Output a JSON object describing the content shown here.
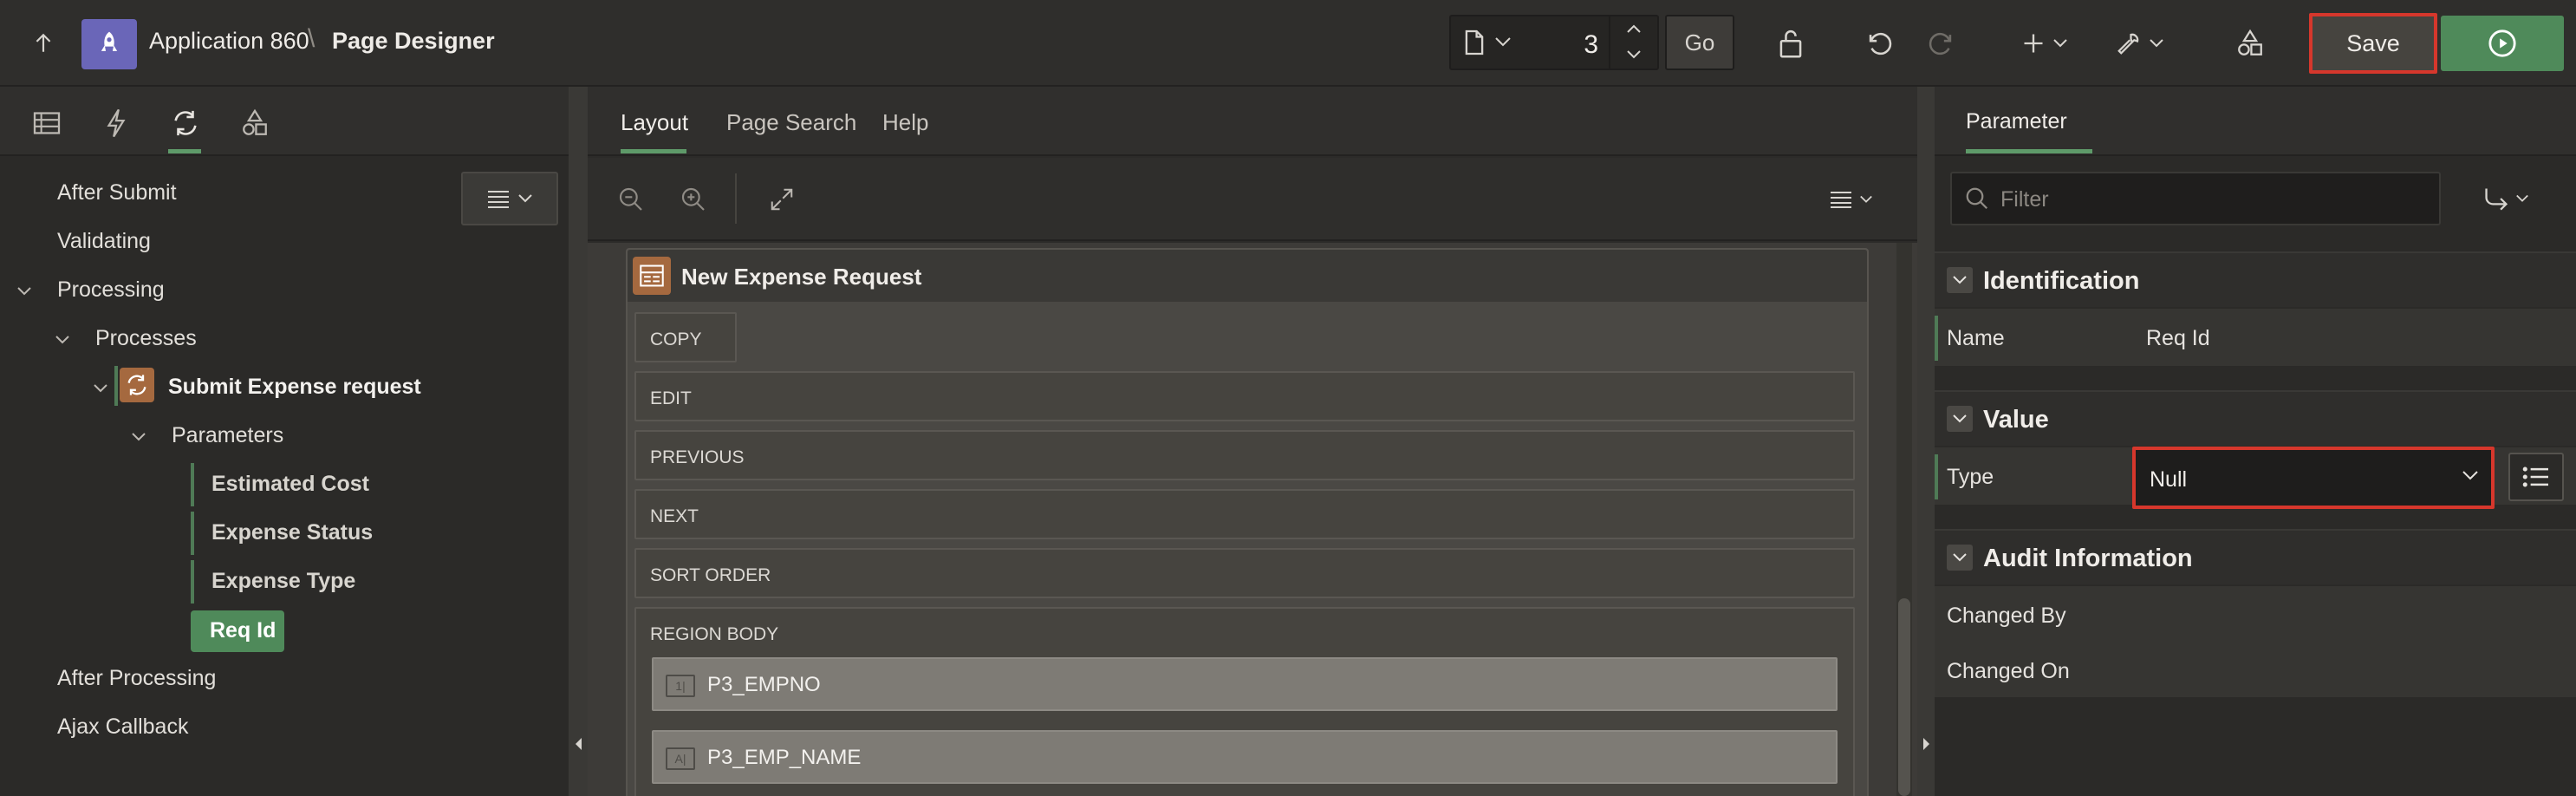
{
  "header": {
    "app_name": "Application 860",
    "separator": "\\",
    "page_title": "Page Designer",
    "page_number": "3",
    "go_label": "Go",
    "save_label": "Save"
  },
  "left_tree": {
    "items": [
      {
        "label": "After Submit"
      },
      {
        "label": "Validating"
      },
      {
        "label": "Processing"
      },
      {
        "label": "Processes"
      },
      {
        "label": "Submit Expense request"
      },
      {
        "label": "Parameters"
      }
    ],
    "parameters": [
      "Estimated Cost",
      "Expense Status",
      "Expense Type"
    ],
    "selected_parameter": "Req Id",
    "after": [
      "After Processing",
      "Ajax Callback"
    ]
  },
  "center": {
    "tabs": [
      "Layout",
      "Page Search",
      "Help"
    ],
    "region_title": "New Expense Request",
    "slots": [
      "COPY",
      "EDIT",
      "PREVIOUS",
      "NEXT",
      "SORT ORDER",
      "REGION BODY"
    ],
    "items": [
      {
        "icon_text": "1|",
        "label": "P3_EMPNO"
      },
      {
        "icon_text": "A|",
        "label": "P3_EMP_NAME"
      }
    ]
  },
  "right": {
    "tab": "Parameter",
    "filter_placeholder": "Filter",
    "groups": {
      "identification": {
        "title": "Identification",
        "name_label": "Name",
        "name_value": "Req Id"
      },
      "value": {
        "title": "Value",
        "type_label": "Type",
        "type_value": "Null"
      },
      "audit": {
        "title": "Audit Information",
        "changed_by": "Changed By",
        "changed_on": "Changed On"
      }
    }
  },
  "colors": {
    "accent_green": "#4f8a5a",
    "highlight_red": "#d6372c",
    "app_logo": "#6a66b8",
    "process_icon": "#a5693f"
  }
}
